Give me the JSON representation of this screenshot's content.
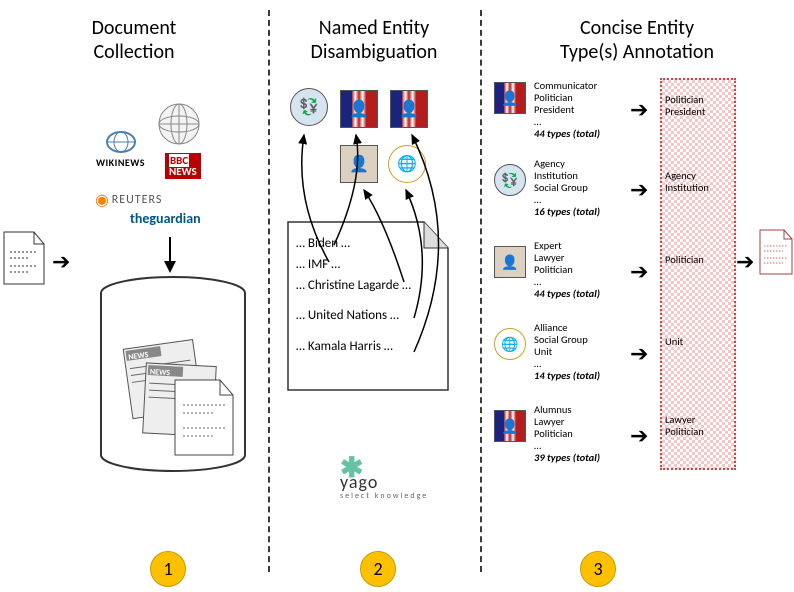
{
  "titles": {
    "s1a": "Document",
    "s1b": "Collection",
    "s2a": "Named Entity",
    "s2b": "Disambiguation",
    "s3a": "Concise Entity",
    "s3b": "Type(s) Annotation"
  },
  "steps": {
    "n1": "1",
    "n2": "2",
    "n3": "3"
  },
  "sources": {
    "wikinews": "WIKINEWS",
    "bbc_top": "BBC",
    "bbc_bottom": "NEWS",
    "reuters": "REUTERS",
    "guardian": "theguardian"
  },
  "db_label_a": "NEWS",
  "db_label_b": "NEWS",
  "doc_lines": {
    "l1": "… Biden …",
    "l2": "… IMF …",
    "l3": "… Christine  Lagarde …",
    "l4": "… United  Nations …",
    "l5": "… Kamala  Harris …"
  },
  "yago": "yago",
  "yago_sub": "select knowledge",
  "entities": [
    {
      "types": [
        "Communicator",
        "Politician",
        "President",
        "…"
      ],
      "total": "44 types (total)",
      "result": [
        "Politician",
        "President"
      ]
    },
    {
      "types": [
        "Agency",
        "Institution",
        "Social Group",
        "…"
      ],
      "total": "16 types (total)",
      "result": [
        "Agency",
        "Institution"
      ]
    },
    {
      "types": [
        "Expert",
        "Lawyer",
        "Politician",
        "…"
      ],
      "total": "44 types (total)",
      "result": [
        "Politician"
      ]
    },
    {
      "types": [
        "Alliance",
        "Social Group",
        "Unit",
        "…"
      ],
      "total": "14 types (total)",
      "result": [
        "Unit"
      ]
    },
    {
      "types": [
        "Alumnus",
        "Lawyer",
        "Politician",
        "…"
      ],
      "total": "39 types (total)",
      "result": [
        "Lawyer",
        "Politician"
      ]
    }
  ]
}
